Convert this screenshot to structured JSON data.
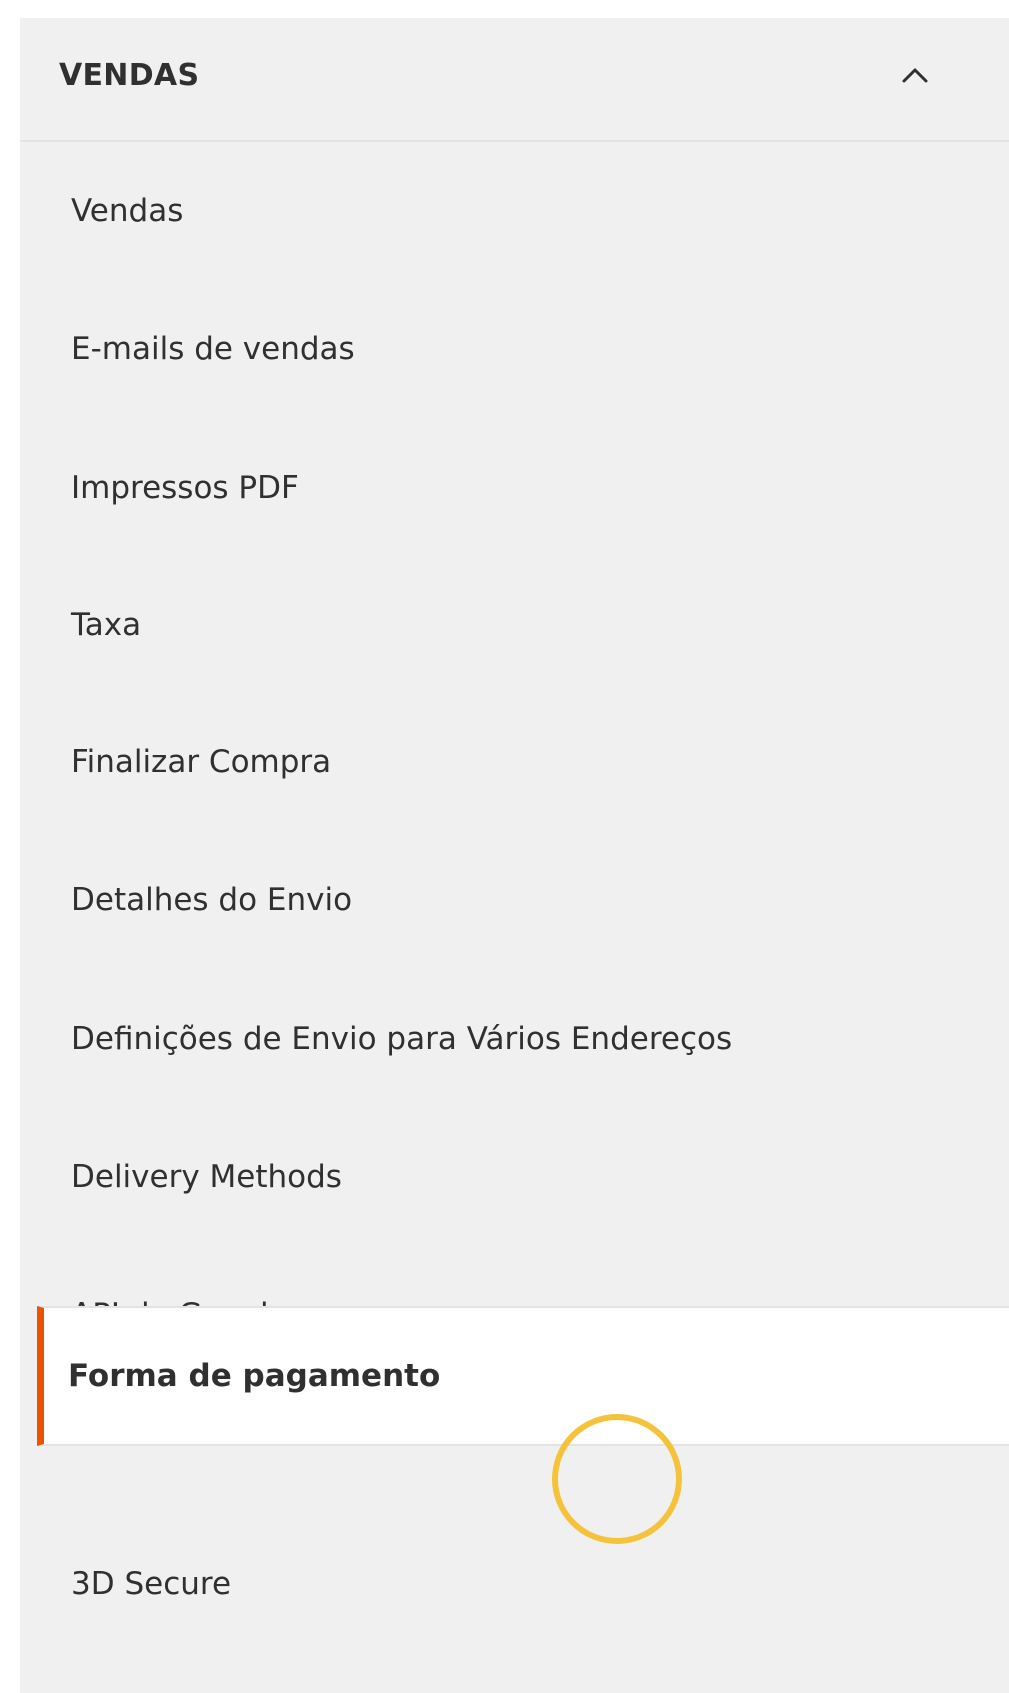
{
  "section": {
    "title": "VENDAS",
    "toggle_icon": "chevron-up-icon",
    "expanded": true
  },
  "nav": {
    "items": [
      {
        "label": "Vendas",
        "active": false
      },
      {
        "label": "E-mails de vendas",
        "active": false
      },
      {
        "label": "Impressos PDF",
        "active": false
      },
      {
        "label": "Taxa",
        "active": false
      },
      {
        "label": "Finalizar Compra",
        "active": false
      },
      {
        "label": "Detalhes do Envio",
        "active": false
      },
      {
        "label": "Definições de Envio para Vários Endereços",
        "active": false
      },
      {
        "label": "Delivery Methods",
        "active": false
      },
      {
        "label": "API do Google",
        "active": false
      },
      {
        "label": "Forma de pagamento",
        "active": true
      },
      {
        "label": "3D Secure",
        "active": false
      }
    ]
  },
  "colors": {
    "panel_background": "#f0f0f0",
    "active_background": "#ffffff",
    "active_accent": "#eb5202",
    "text": "#303030",
    "cursor_highlight": "#f5c33b"
  }
}
